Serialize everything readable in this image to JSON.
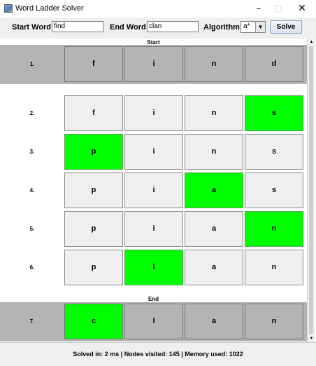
{
  "window": {
    "title": "Word Ladder Solver",
    "minimize_glyph": "–",
    "maximize_glyph": "□",
    "close_glyph": "✕"
  },
  "toolbar": {
    "start_label": "Start Word:",
    "start_value": "find",
    "end_label": "End Word:",
    "end_value": "clan",
    "algorithm_label": "Algorithm:",
    "algorithm_value": "a*",
    "solve_label": "Solve",
    "dropdown_glyph": "▼"
  },
  "labels": {
    "start": "Start",
    "end": "End"
  },
  "rows": [
    {
      "num": "1.",
      "letters": [
        "f",
        "i",
        "n",
        "d"
      ],
      "changed": [],
      "highlight": true
    },
    {
      "num": "2.",
      "letters": [
        "f",
        "i",
        "n",
        "s"
      ],
      "changed": [
        3
      ],
      "highlight": false
    },
    {
      "num": "3.",
      "letters": [
        "p",
        "i",
        "n",
        "s"
      ],
      "changed": [
        0
      ],
      "highlight": false
    },
    {
      "num": "4.",
      "letters": [
        "p",
        "i",
        "a",
        "s"
      ],
      "changed": [
        2
      ],
      "highlight": false
    },
    {
      "num": "5.",
      "letters": [
        "p",
        "i",
        "a",
        "n"
      ],
      "changed": [
        3
      ],
      "highlight": false
    },
    {
      "num": "6.",
      "letters": [
        "p",
        "l",
        "a",
        "n"
      ],
      "changed": [
        1
      ],
      "highlight": false
    },
    {
      "num": "7.",
      "letters": [
        "c",
        "l",
        "a",
        "n"
      ],
      "changed": [
        0
      ],
      "highlight": true
    }
  ],
  "status": "Solved in: 2 ms   |   Nodes visited: 145   |   Memory used: 1022",
  "scrollbar": {
    "up_glyph": "▲",
    "down_glyph": "▼"
  },
  "colors": {
    "changed": "#00ff00",
    "band": "#b4b4b4",
    "cell": "#efefef"
  }
}
